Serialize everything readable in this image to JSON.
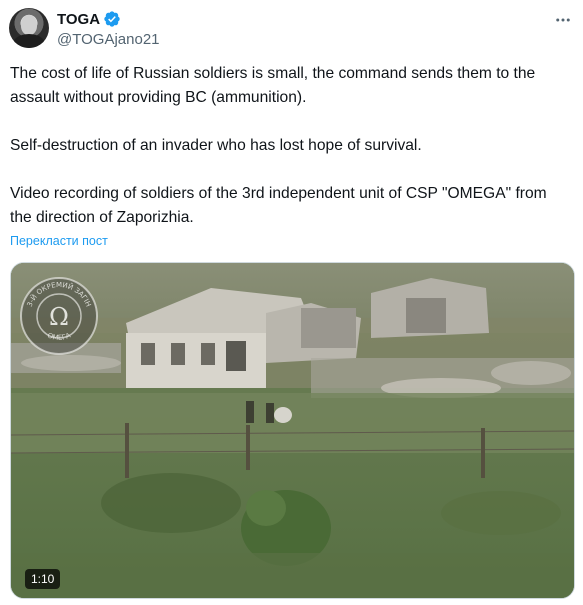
{
  "author": {
    "display_name": "TOGA",
    "handle": "@TOGAjano21",
    "verified_icon": "verified-badge-icon",
    "avatar_icon": "avatar-portrait"
  },
  "menu": {
    "more_icon": "more-icon"
  },
  "tweet": {
    "paragraphs": [
      "The cost of life of Russian soldiers is small, the command sends them to the assault without providing BC (ammunition).",
      "Self-destruction of an invader who has lost hope of survival.",
      "Video recording of soldiers of the 3rd independent unit of CSP \"OMEGA\" from the direction of Zaporizhia."
    ],
    "translate_label": "Перекласти пост"
  },
  "video": {
    "duration": "1:10",
    "watermark_top_text": "3-Й ОКРЕМИЙ ЗАГІН",
    "watermark_symbol": "Ω",
    "watermark_bottom_text": "ОМЕГА"
  },
  "colors": {
    "accent": "#1d9bf0",
    "text": "#0f1419",
    "secondary": "#536471",
    "border": "#cfd9de"
  }
}
